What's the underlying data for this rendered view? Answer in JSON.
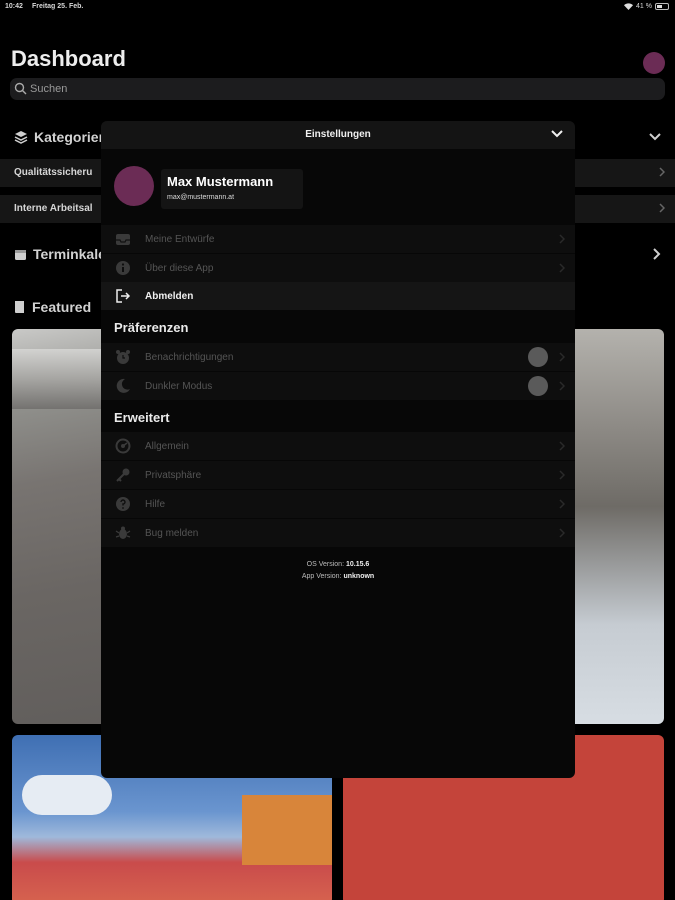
{
  "status_bar": {
    "time": "10:42",
    "date": "Freitag 25. Feb.",
    "battery": "41 %"
  },
  "dashboard": {
    "title": "Dashboard",
    "search_placeholder": "Suchen",
    "sections": {
      "categories": "Kategorien",
      "calendar": "Terminkale",
      "featured": "Featured"
    },
    "category_rows": [
      "Qualitätssicheru",
      "Interne Arbeitsal"
    ]
  },
  "settings": {
    "title": "Einstellungen",
    "profile": {
      "name": "Max Mustermann",
      "email": "max@mustermann.at"
    },
    "account_items": [
      {
        "label": "Meine Entwürfe",
        "icon": "tray-icon"
      },
      {
        "label": "Über diese App",
        "icon": "info-icon"
      },
      {
        "label": "Abmelden",
        "icon": "logout-icon"
      }
    ],
    "preferences_title": "Präferenzen",
    "preference_items": [
      {
        "label": "Benachrichtigungen",
        "icon": "alarm-icon",
        "enabled": false
      },
      {
        "label": "Dunkler Modus",
        "icon": "moon-icon",
        "enabled": false
      }
    ],
    "advanced_title": "Erweitert",
    "advanced_items": [
      {
        "label": "Allgemein",
        "icon": "gear-icon"
      },
      {
        "label": "Privatsphäre",
        "icon": "key-icon"
      },
      {
        "label": "Hilfe",
        "icon": "help-icon"
      },
      {
        "label": "Bug melden",
        "icon": "bug-icon"
      }
    ],
    "os_version_label": "OS Version:",
    "os_version": "10.15.6",
    "app_version_label": "App Version:",
    "app_version": "unknown"
  },
  "colors": {
    "accent": "#6b2c55",
    "background": "#000000",
    "sheet": "#070707"
  }
}
